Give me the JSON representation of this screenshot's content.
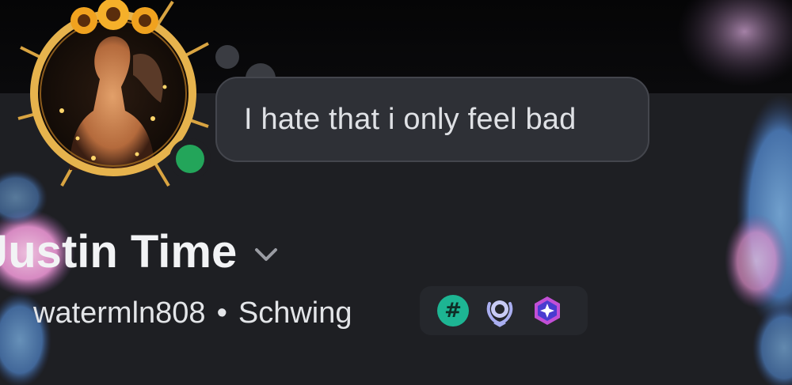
{
  "speech_bubble": {
    "text": "I hate that i only feel bad"
  },
  "profile": {
    "display_name": "Justin Time",
    "username": "watermln808",
    "separator": "•",
    "pronoun_or_tag": "Schwing",
    "status": "online"
  },
  "badges": [
    {
      "name": "hashtag-badge",
      "glyph": "#"
    },
    {
      "name": "laurel-badge"
    },
    {
      "name": "nitro-gem-badge"
    }
  ],
  "colors": {
    "background": "#1e1f23",
    "banner": "#050506",
    "online": "#23a55a",
    "bubble": "#2e3036",
    "hash_badge": "#1db593"
  }
}
